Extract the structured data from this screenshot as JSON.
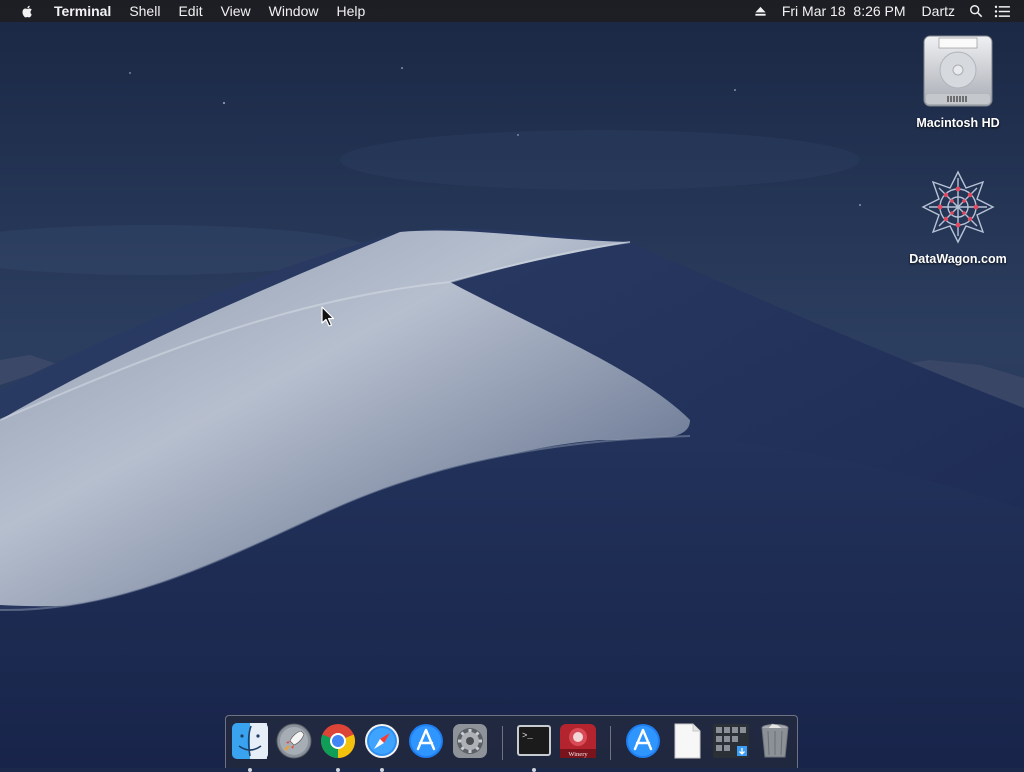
{
  "menubar": {
    "apple_icon": "apple-logo-icon",
    "app_name": "Terminal",
    "menus": [
      "Shell",
      "Edit",
      "View",
      "Window",
      "Help"
    ],
    "status": {
      "eject_icon": "eject-icon",
      "datetime": "Fri Mar 18  8:26 PM",
      "user": "Dartz",
      "spotlight_icon": "magnifier-icon",
      "notification_icon": "list-icon"
    }
  },
  "desktop": {
    "icons": [
      {
        "label": "Macintosh HD",
        "icon": "hard-drive-icon"
      },
      {
        "label": "DataWagon.com",
        "icon": "network-volume-icon"
      }
    ]
  },
  "dock": {
    "items": [
      {
        "name": "Finder",
        "icon": "finder-icon",
        "running": true
      },
      {
        "name": "Launchpad",
        "icon": "launchpad-icon",
        "running": false
      },
      {
        "name": "Google Chrome",
        "icon": "chrome-icon",
        "running": true
      },
      {
        "name": "Safari",
        "icon": "safari-icon",
        "running": true
      },
      {
        "name": "App Store",
        "icon": "app-store-icon",
        "running": false
      },
      {
        "name": "System Preferences",
        "icon": "system-preferences-icon",
        "running": false
      },
      {
        "name": "Terminal",
        "icon": "terminal-icon",
        "running": true
      },
      {
        "name": "Winery",
        "icon": "winery-icon",
        "running": false,
        "badge_text": "Winery"
      },
      {
        "name": "Applications",
        "icon": "app-store-folder-icon",
        "running": false
      },
      {
        "name": "Document",
        "icon": "document-icon",
        "running": false
      },
      {
        "name": "Downloads",
        "icon": "downloads-stack-icon",
        "running": false
      },
      {
        "name": "Trash",
        "icon": "trash-icon",
        "running": false
      }
    ],
    "terminal_glyph": ">_"
  },
  "colors": {
    "menubar_bg": "#1e1e20",
    "sky_top": "#1c2a48",
    "sky_bottom": "#3a4d6e",
    "dune_light": "#a9b3c4",
    "dune_dark": "#1c2c52"
  }
}
